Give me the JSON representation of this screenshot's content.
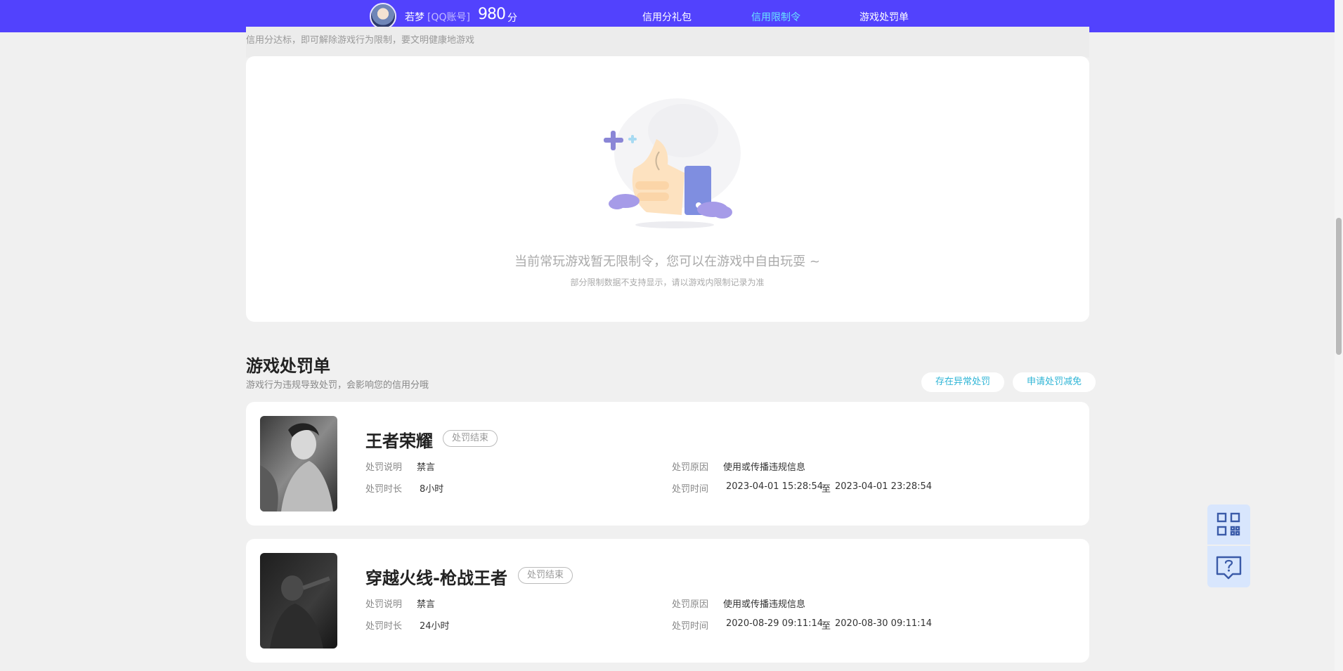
{
  "header": {
    "username": "若梦",
    "account_type": "[QQ账号]",
    "score": "980",
    "score_unit": "分",
    "tabs": [
      {
        "label": "信用分礼包",
        "active": false
      },
      {
        "label": "信用限制令",
        "active": true
      },
      {
        "label": "游戏处罚单",
        "active": false
      }
    ]
  },
  "restriction": {
    "subtitle": "信用分达标，即可解除游戏行为限制，要文明健康地游戏",
    "empty_title": "当前常玩游戏暂无限制令，您可以在游戏中自由玩耍 ~",
    "empty_note": "部分限制数据不支持显示，请以游戏内限制记录为准"
  },
  "penalty": {
    "title": "游戏处罚单",
    "subtitle": "游戏行为违规导致处罚，会影响您的信用分哦",
    "actions": [
      "存在异常处罚",
      "申请处罚减免"
    ],
    "labels": {
      "desc": "处罚说明",
      "duration": "处罚时长",
      "reason": "处罚原因",
      "time": "处罚时间",
      "to": "至"
    },
    "items": [
      {
        "game": "王者荣耀",
        "status": "处罚结束",
        "desc": "禁言",
        "duration": "8小时",
        "reason": "使用或传播违规信息",
        "start": "2023-04-01 15:28:54",
        "end": "2023-04-01 23:28:54"
      },
      {
        "game": "穿越火线-枪战王者",
        "status": "处罚结束",
        "desc": "禁言",
        "duration": "24小时",
        "reason": "使用或传播违规信息",
        "start": "2020-08-29 09:11:14",
        "end": "2020-08-30 09:11:14"
      }
    ]
  },
  "colors": {
    "header_bg": "#5242fd",
    "active_tab": "#69e2ff",
    "action_link": "#2fb5d6",
    "page_bg": "#f0f0f0"
  },
  "float_buttons": [
    "qrcode-icon",
    "help-chat-icon"
  ]
}
